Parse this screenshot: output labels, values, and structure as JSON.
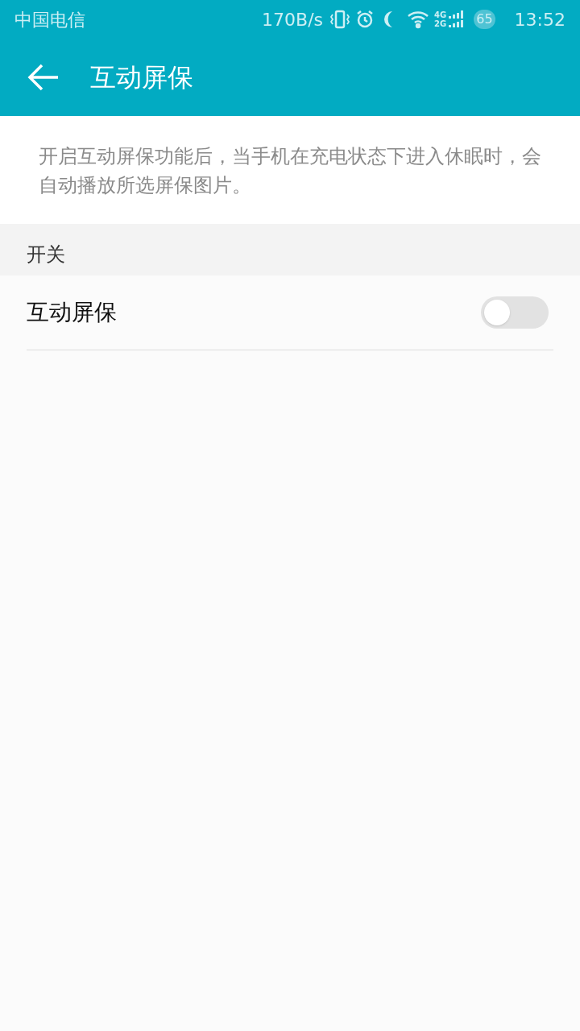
{
  "status_bar": {
    "carrier": "中国电信",
    "speed": "170B/s",
    "network_labels": [
      "4G",
      "2G"
    ],
    "battery": "65",
    "time": "13:52"
  },
  "app_bar": {
    "title": "互动屏保"
  },
  "description": "开启互动屏保功能后，当手机在充电状态下进入休眠时，会自动播放所选屏保图片。",
  "sections": [
    {
      "header": "开关",
      "items": [
        {
          "label": "互动屏保",
          "on": false
        }
      ]
    }
  ]
}
